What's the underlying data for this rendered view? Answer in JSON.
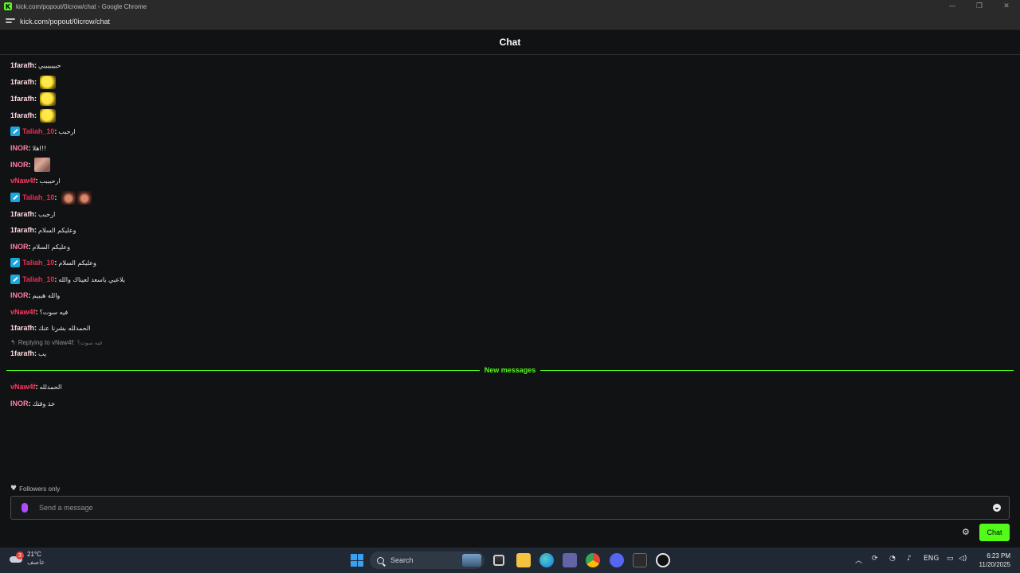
{
  "window": {
    "title": "kick.com/popout/0icrow/chat - Google Chrome",
    "favicon": "K",
    "controls": [
      "—",
      "❐",
      "✕"
    ]
  },
  "address": {
    "url": "kick.com/popout/0icrow/chat"
  },
  "chat": {
    "title": "Chat"
  },
  "colors": {
    "accent": "#53fc18",
    "user_1farafh": "#ffd9e1",
    "user_taliah": "#e62e54",
    "user_inor": "#ff7fa4",
    "user_vnaw4f": "#ff3860"
  },
  "messages": [
    {
      "user": "1farafh",
      "text": "حبيبيبيبي",
      "color": "#ffd9e1"
    },
    {
      "user": "1farafh",
      "emote": "yellow-emote",
      "color": "#ffd9e1"
    },
    {
      "user": "1farafh",
      "emote": "yellow-emote",
      "color": "#ffd9e1"
    },
    {
      "user": "1farafh",
      "emote": "yellow-emote",
      "color": "#ffd9e1"
    },
    {
      "user": "Taliah_10",
      "badge": "moderator-badge",
      "text": "ارحبب",
      "color": "#e62e54"
    },
    {
      "user": "INOR",
      "text": "اهلا!!",
      "color": "#ff7fa4"
    },
    {
      "user": "INOR",
      "emote": "pink-emote",
      "color": "#ff7fa4"
    },
    {
      "user": "vNaw4f",
      "text": "ارحبببب",
      "color": "#ff3860"
    },
    {
      "user": "Taliah_10",
      "badge": "moderator-badge",
      "emote": "face-emote-x2",
      "color": "#e62e54"
    },
    {
      "user": "1farafh",
      "text": "ارحبب",
      "color": "#ffd9e1"
    },
    {
      "user": "1farafh",
      "text": "وعليكم السلام",
      "color": "#ffd9e1"
    },
    {
      "user": "INOR",
      "text": "وعليكم السلام",
      "color": "#ff7fa4"
    },
    {
      "user": "Taliah_10",
      "badge": "moderator-badge",
      "text": "وعليكم السلام",
      "color": "#e62e54"
    },
    {
      "user": "Taliah_10",
      "badge": "moderator-badge",
      "text": "يلاعبي ياسعد لعيناك والله",
      "color": "#e62e54"
    },
    {
      "user": "INOR",
      "text": "والله هببيم",
      "color": "#ff7fa4"
    },
    {
      "user": "vNaw4f",
      "text": "فيه سوت؟",
      "color": "#ff3860"
    },
    {
      "user": "1farafh",
      "text": "الحمدلله بشرنا عنك",
      "color": "#ffd9e1"
    },
    {
      "user": "1farafh",
      "text": "يب",
      "color": "#ffd9e1"
    }
  ],
  "reply": {
    "label": "Replying to vNaw4f:",
    "quote": "فيه سوت؟"
  },
  "divider": {
    "label": "New messages"
  },
  "new_messages": [
    {
      "user": "vNaw4f",
      "text": "الحمدلله",
      "color": "#ff3860"
    },
    {
      "user": "INOR",
      "text": "خذ وقتك",
      "color": "#ff7fa4"
    }
  ],
  "composer": {
    "followers_only": "Followers only",
    "placeholder": "Send a message",
    "send_label": "Chat"
  },
  "taskbar": {
    "weather_temp": "21°C",
    "weather_desc": "عاصف",
    "weather_badge": "3",
    "search_label": "Search",
    "tray_lang": "ENG",
    "time": "6:23 PM",
    "date": "11/20/2025"
  }
}
